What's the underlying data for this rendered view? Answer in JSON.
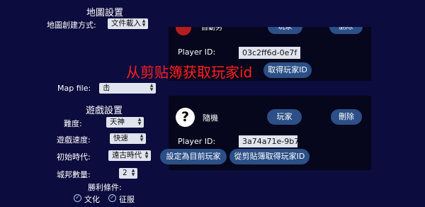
{
  "map_settings": {
    "title": "地圖設置",
    "creation_label": "地圖創建方式:",
    "creation_value": "文件載入",
    "map_file_label": "Map file:",
    "map_file_value": "击"
  },
  "game_settings": {
    "title": "遊戲設置",
    "difficulty_label": "難度:",
    "difficulty_value": "天神",
    "speed_label": "遊戲速度:",
    "speed_value": "快速",
    "era_label": "初始時代:",
    "era_value": "遠古時代",
    "city_states_label": "城邦數量:",
    "city_states_value": "2",
    "victory_label": "勝利條件:",
    "victory_options": [
      "文化",
      "征服"
    ]
  },
  "player_panel_top": {
    "civ_name_partial": "自動另",
    "btn_player_partial": "玩家",
    "btn_remove_partial": "删除",
    "player_id_label": "Player ID:",
    "player_id_value": "03c2ff6d-0e7f",
    "btn_paste_partial": "取得玩家ID"
  },
  "player_panel_bottom": {
    "civ_icon": "?",
    "civ_name": "隨機",
    "btn_player": "玩家",
    "btn_remove": "刪除",
    "player_id_label": "Player ID:",
    "player_id_value": "3a74a71e-9b7",
    "btn_set_current": "設定為目前玩家",
    "btn_paste": "從剪貼簿取得玩家ID"
  },
  "overlay": {
    "text": "从剪贴簿获取玩家id",
    "color": "#ff2020"
  },
  "colors": {
    "background": "#0c0c3e",
    "panel": "#06061c",
    "button": "#2b4f86",
    "field": "#dfe4ee"
  }
}
